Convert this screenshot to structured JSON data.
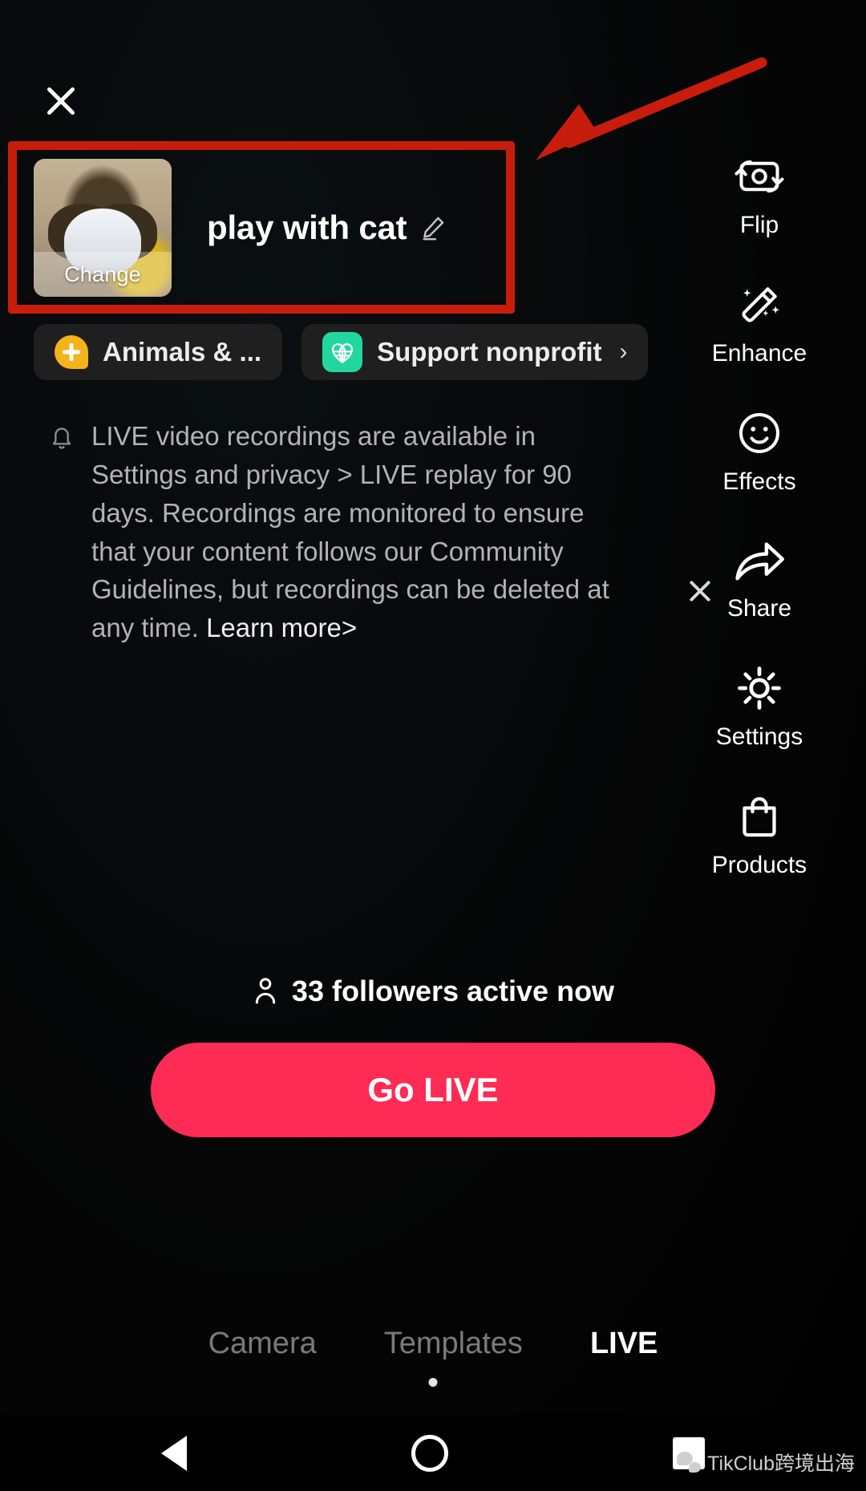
{
  "header": {
    "close_label": "Close"
  },
  "live_title": {
    "text": "play with cat",
    "change_label": "Change",
    "edit_icon": "pencil-icon"
  },
  "chips": [
    {
      "label": "Animals & ...",
      "icon": "animals-topic-icon",
      "color": "#f5b31b",
      "chevron": ""
    },
    {
      "label": "Support nonprofit",
      "icon": "nonprofit-globe-heart-icon",
      "color": "#22d6a0",
      "chevron": "›"
    }
  ],
  "notice": {
    "icon": "bell-icon",
    "body": "LIVE video recordings are available in Settings and privacy > LIVE replay for 90 days. Recordings are monitored to ensure that your content follows our Community Guidelines, but recordings can be deleted at any time. ",
    "link": "Learn more>",
    "close_label": "Dismiss"
  },
  "rail": [
    {
      "label": "Flip",
      "icon": "flip-camera-icon"
    },
    {
      "label": "Enhance",
      "icon": "magic-wand-icon"
    },
    {
      "label": "Effects",
      "icon": "smiley-face-icon"
    },
    {
      "label": "Share",
      "icon": "share-arrow-icon"
    },
    {
      "label": "Settings",
      "icon": "gear-icon"
    },
    {
      "label": "Products",
      "icon": "shopping-bag-icon"
    }
  ],
  "followers": {
    "icon": "person-icon",
    "text": "33 followers active now"
  },
  "go_live": {
    "label": "Go LIVE",
    "color": "#fe2c55"
  },
  "tabs": [
    {
      "label": "Camera",
      "active": false
    },
    {
      "label": "Templates",
      "active": false
    },
    {
      "label": "LIVE",
      "active": true
    }
  ],
  "navbar": {
    "back": "back-button",
    "home": "home-button",
    "recent": "recent-apps-button"
  },
  "watermark": {
    "text": "TikClub跨境出海"
  },
  "annotation": {
    "color": "#c81d0c",
    "shape": "arrow-pointing-to-title-box"
  }
}
